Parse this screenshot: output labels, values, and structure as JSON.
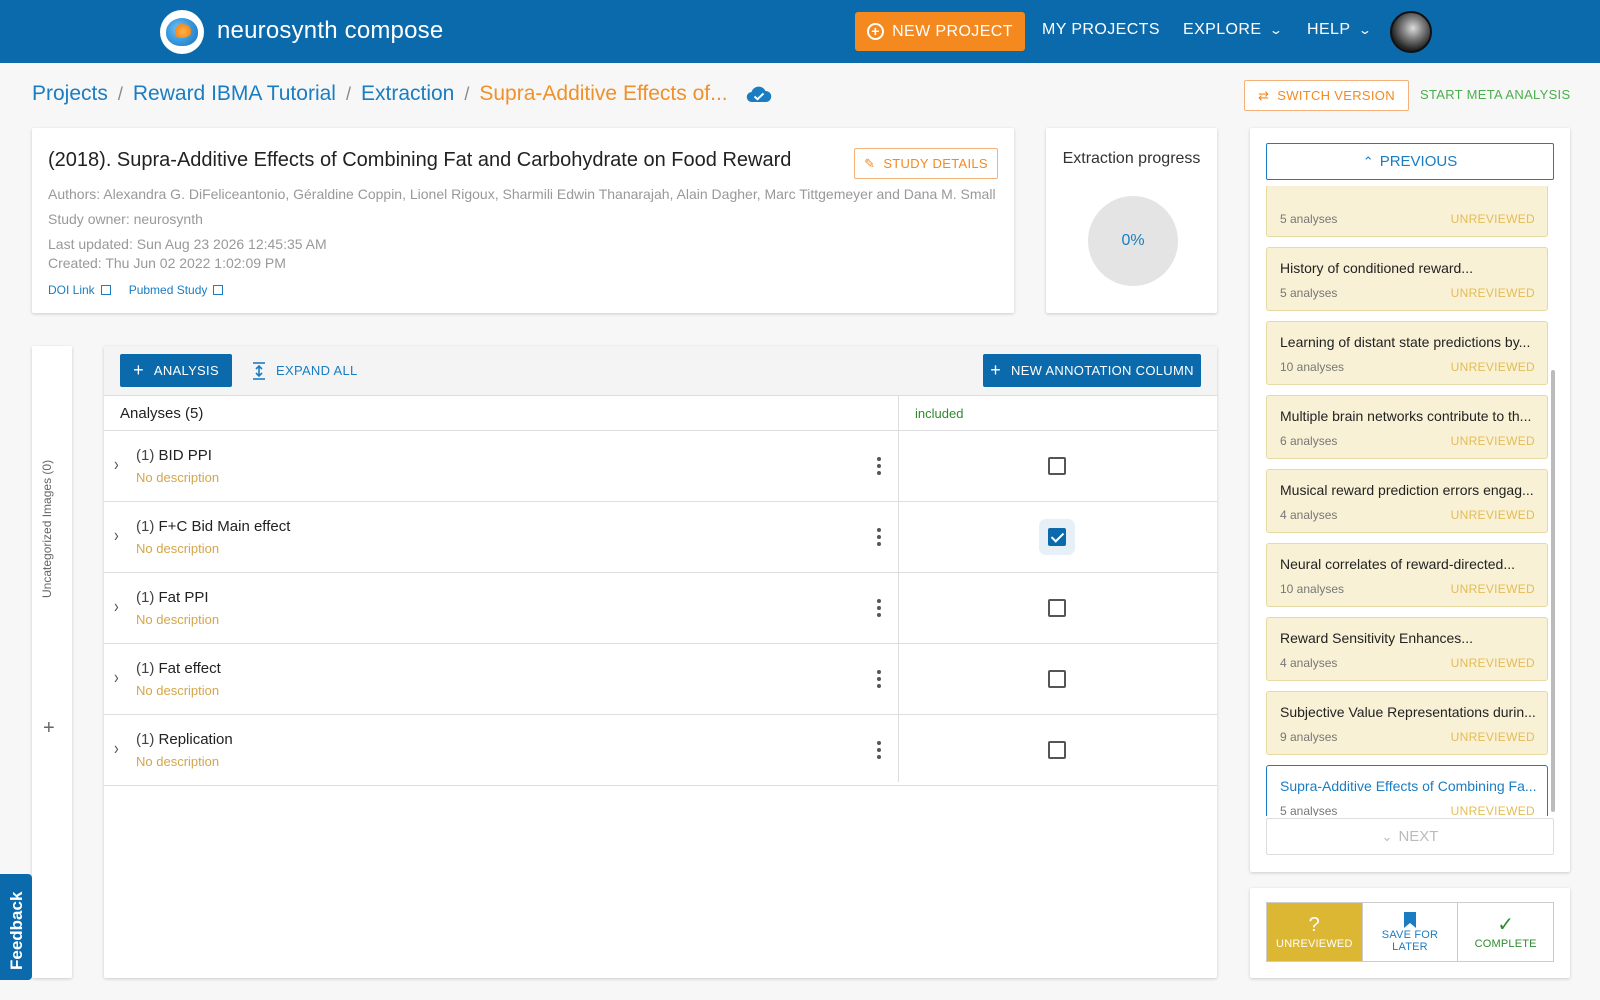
{
  "header": {
    "app_title": "neurosynth compose",
    "new_project": "NEW PROJECT",
    "my_projects": "MY PROJECTS",
    "explore": "EXPLORE",
    "help": "HELP"
  },
  "breadcrumb": {
    "items": [
      "Projects",
      "Reward IBMA Tutorial",
      "Extraction"
    ],
    "current": "Supra-Additive Effects of...",
    "separator": "/"
  },
  "actions": {
    "switch_version": "SWITCH VERSION",
    "start_meta": "START META ANALYSIS"
  },
  "study": {
    "title": "(2018). Supra-Additive Effects of Combining Fat and Carbohydrate on Food Reward",
    "details_button": "STUDY DETAILS",
    "authors": "Authors: Alexandra G. DiFeliceantonio, Géraldine Coppin, Lionel Rigoux, Sharmili Edwin Thanarajah, Alain Dagher, Marc Tittgemeyer and Dana M. Small",
    "owner": "Study owner: neurosynth",
    "last_updated": "Last updated: Sun Aug 23 2026 12:45:35 AM",
    "created": "Created: Thu Jun 02 2022 1:02:09 PM",
    "doi_link": "DOI Link",
    "pubmed_link": "Pubmed Study"
  },
  "progress": {
    "title": "Extraction progress",
    "value": "0%"
  },
  "uncategorized": {
    "label": "Uncategorized Images (0)"
  },
  "analyses": {
    "add_button": "ANALYSIS",
    "expand_all": "EXPAND ALL",
    "new_column": "NEW ANNOTATION COLUMN",
    "header": "Analyses (5)",
    "column_included": "included",
    "rows": [
      {
        "num": "(1)",
        "name": "BID PPI",
        "desc": "No description",
        "included": false
      },
      {
        "num": "(1)",
        "name": "F+C Bid Main effect",
        "desc": "No description",
        "included": true
      },
      {
        "num": "(1)",
        "name": "Fat PPI",
        "desc": "No description",
        "included": false
      },
      {
        "num": "(1)",
        "name": "Fat effect",
        "desc": "No description",
        "included": false
      },
      {
        "num": "(1)",
        "name": "Replication",
        "desc": "No description",
        "included": false
      }
    ]
  },
  "studylist": {
    "previous": "PREVIOUS",
    "next": "NEXT",
    "items": [
      {
        "name": "",
        "count": "5 analyses",
        "status": "UNREVIEWED"
      },
      {
        "name": "History of conditioned reward...",
        "count": "5 analyses",
        "status": "UNREVIEWED"
      },
      {
        "name": "Learning of distant state predictions by...",
        "count": "10 analyses",
        "status": "UNREVIEWED"
      },
      {
        "name": "Multiple brain networks contribute to th...",
        "count": "6 analyses",
        "status": "UNREVIEWED"
      },
      {
        "name": "Musical reward prediction errors engag...",
        "count": "4 analyses",
        "status": "UNREVIEWED"
      },
      {
        "name": "Neural correlates of reward-directed...",
        "count": "10 analyses",
        "status": "UNREVIEWED"
      },
      {
        "name": "Reward Sensitivity Enhances...",
        "count": "4 analyses",
        "status": "UNREVIEWED"
      },
      {
        "name": "Subjective Value Representations durin...",
        "count": "9 analyses",
        "status": "UNREVIEWED"
      },
      {
        "name": "Supra-Additive Effects of Combining Fa...",
        "count": "5 analyses",
        "status": "UNREVIEWED"
      }
    ]
  },
  "status_buttons": {
    "unreviewed": "UNREVIEWED",
    "save_for_later": "SAVE FOR LATER",
    "complete": "COMPLETE"
  },
  "feedback": "Feedback",
  "colors": {
    "brand_blue": "#0b6aab",
    "accent_orange": "#f4891f",
    "unreviewed_yellow": "#dcb733",
    "success_green": "#2e8b2e"
  },
  "icons": {
    "add_project": "plus-circle-icon",
    "cloud_saved": "cloud-check-icon",
    "switch": "swap-icon",
    "edit": "pencil-icon",
    "external": "external-link-icon",
    "expand": "expand-vertical-icon",
    "unreviewed": "question-icon",
    "save_later": "bookmark-icon",
    "complete": "check-icon"
  }
}
